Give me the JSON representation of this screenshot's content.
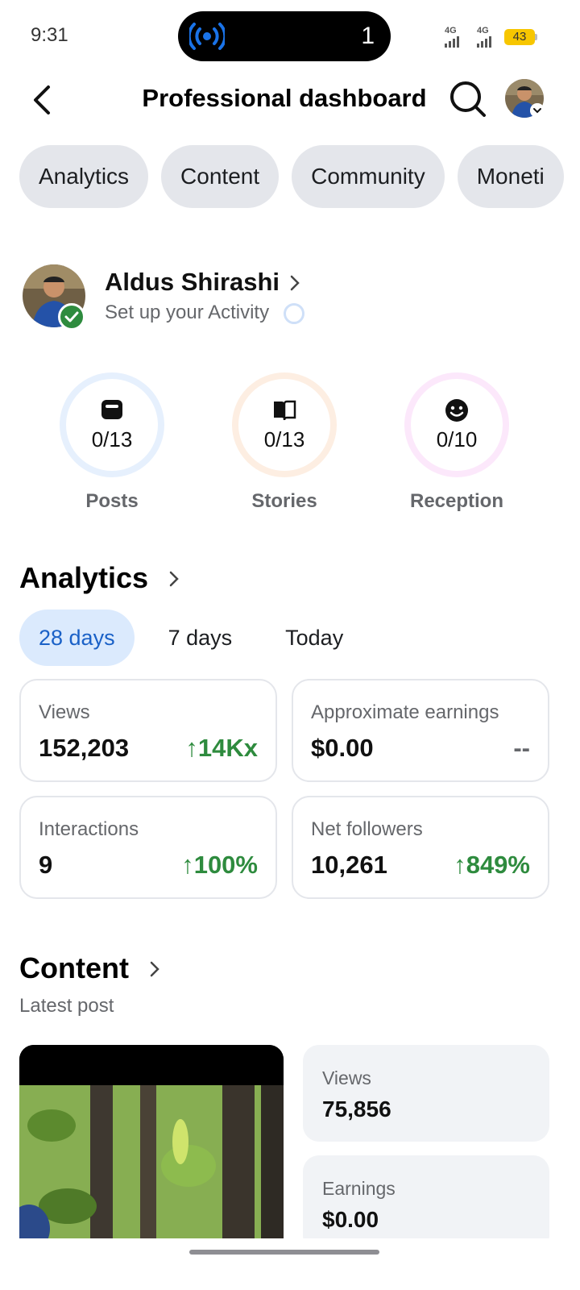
{
  "status_bar": {
    "time": "9:31",
    "live_count": "1",
    "signal_1": "4G",
    "signal_2": "4G",
    "battery": "43"
  },
  "header": {
    "title": "Professional dashboard",
    "back_icon": "chevron-left-icon",
    "search_icon": "search-icon"
  },
  "tabs": [
    {
      "label": "Analytics"
    },
    {
      "label": "Content"
    },
    {
      "label": "Community"
    },
    {
      "label": "Moneti"
    }
  ],
  "profile": {
    "name": "Aldus Shirashi",
    "subtitle": "Set up your Activity"
  },
  "activity": [
    {
      "icon": "post-icon",
      "value": "0/13",
      "label": "Posts",
      "ring_color": "#e6f0fd"
    },
    {
      "icon": "book-icon",
      "value": "0/13",
      "label": "Stories",
      "ring_color": "#fdeee2"
    },
    {
      "icon": "smile-icon",
      "value": "0/10",
      "label": "Reception",
      "ring_color": "#fce8fb"
    }
  ],
  "analytics": {
    "title": "Analytics",
    "ranges": [
      {
        "label": "28 days",
        "active": true
      },
      {
        "label": "7 days",
        "active": false
      },
      {
        "label": "Today",
        "active": false
      }
    ],
    "cards": [
      {
        "label": "Views",
        "value": "152,203",
        "change": "↑14Kx"
      },
      {
        "label": "Approximate earnings",
        "value": "$0.00",
        "change": "--"
      },
      {
        "label": "Interactions",
        "value": "9",
        "change": "↑100%"
      },
      {
        "label": "Net followers",
        "value": "10,261",
        "change": "↑849%"
      }
    ]
  },
  "content": {
    "title": "Content",
    "subtitle": "Latest post",
    "stats": [
      {
        "label": "Views",
        "value": "75,856"
      },
      {
        "label": "Earnings",
        "value": "$0.00"
      }
    ]
  },
  "colors": {
    "accent": "#1a61c7",
    "positive": "#2e8b3e",
    "tab_bg": "#e4e6eb"
  }
}
